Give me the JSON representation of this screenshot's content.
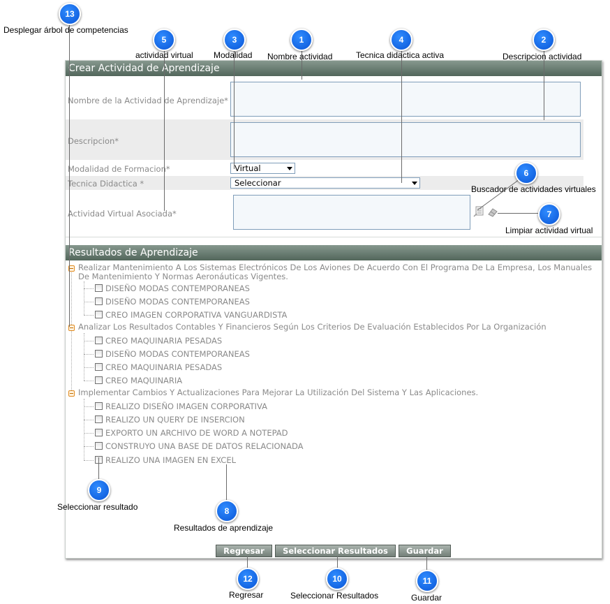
{
  "form": {
    "header": "Crear Actividad de Aprendizaje",
    "fields": [
      {
        "label": "Nombre de la Actividad de Aprendizaje*",
        "value": ""
      },
      {
        "label": "Descripcion*",
        "value": ""
      },
      {
        "label": "Modalidad de Formacion*",
        "value": "Virtual"
      },
      {
        "label": "Tecnica Didactica *",
        "value": "Seleccionar"
      },
      {
        "label": "Actividad Virtual Asociada*",
        "value": ""
      }
    ]
  },
  "results": {
    "header": "Resultados de Aprendizaje",
    "competencies": [
      {
        "text": "Realizar Mantenimiento A Los Sistemas Electrónicos De Los Aviones De Acuerdo Con El Programa De La Empresa, Los Manuales De Mantenimiento Y Normas Aeronáuticas Vigentes.",
        "items": [
          "DISEÑO MODAS CONTEMPORANEAS",
          "DISEÑO MODAS CONTEMPORANEAS",
          "CREO IMAGEN CORPORATIVA VANGUARDISTA"
        ]
      },
      {
        "text": "Analizar Los Resultados Contables Y Financieros Según Los Criterios De Evaluación Establecidos Por La Organización",
        "items": [
          "CREO MAQUINARIA PESADAS",
          "DISEÑO MODAS CONTEMPORANEAS",
          "CREO MAQUINARIA PESADAS",
          "CREO MAQUINARIA"
        ]
      },
      {
        "text": "Implementar Cambios Y Actualizaciones Para Mejorar La Utilización Del Sistema Y Las Aplicaciones.",
        "items": [
          "REALIZO DISEÑO IMAGEN CORPORATIVA",
          "REALIZO UN QUERY DE INSERCION",
          "EXPORTO UN ARCHIVO DE WORD A NOTEPAD",
          "CONSTRUYO UNA BASE DE DATOS RELACIONADA",
          "REALIZO UNA IMAGEN EN EXCEL"
        ]
      }
    ]
  },
  "buttons": {
    "back": "Regresar",
    "select_results": "Seleccionar Resultados",
    "save": "Guardar"
  },
  "annotations": [
    {
      "num": "1",
      "label": "Nombre actividad"
    },
    {
      "num": "2",
      "label": "Descripcion actividad"
    },
    {
      "num": "3",
      "label": "Modalidad"
    },
    {
      "num": "4",
      "label": "Tecnica didactica activa"
    },
    {
      "num": "5",
      "label": "actividad virtual"
    },
    {
      "num": "6",
      "label": "Buscador de actividades virtuales"
    },
    {
      "num": "7",
      "label": "Limpiar actividad virtual"
    },
    {
      "num": "8",
      "label": "Resultados de aprendizaje"
    },
    {
      "num": "9",
      "label": "Seleccionar resultado"
    },
    {
      "num": "10",
      "label": "Seleccionar Resultados"
    },
    {
      "num": "11",
      "label": "Guardar"
    },
    {
      "num": "12",
      "label": "Regresar"
    },
    {
      "num": "13",
      "label": "Desplegar árbol de competencias"
    }
  ],
  "icons": {
    "search": "search-list-icon",
    "clear": "eraser-icon",
    "toggle": "collapse-minus-icon",
    "accent": "#1a6ef0",
    "header_color": "#5f7368"
  }
}
